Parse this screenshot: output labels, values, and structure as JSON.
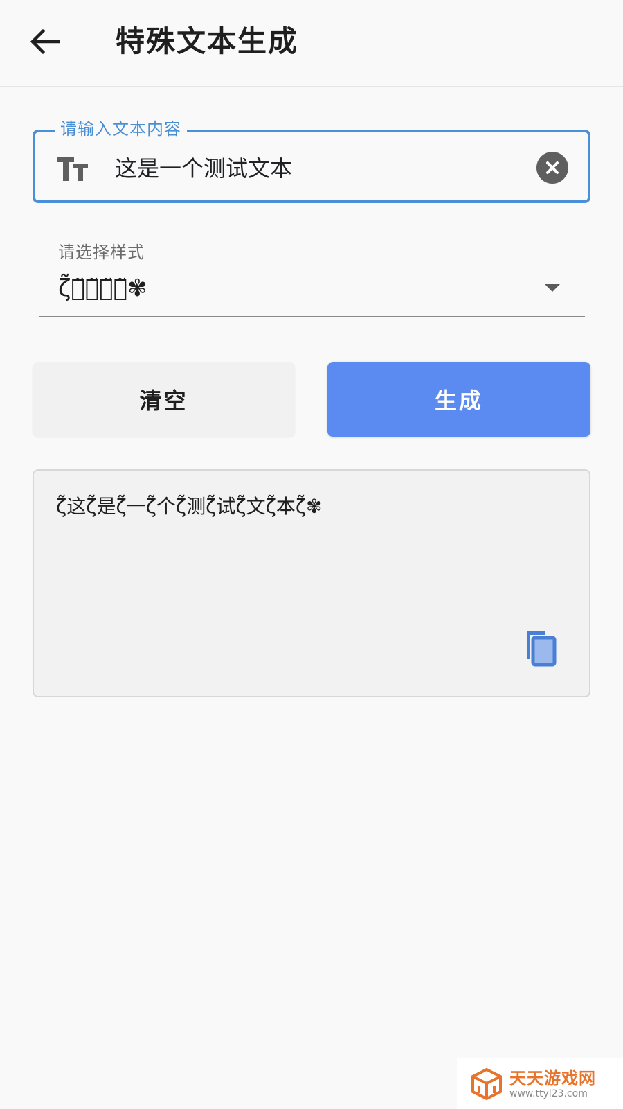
{
  "header": {
    "title": "特殊文本生成",
    "back_icon": "arrow-left-icon"
  },
  "input": {
    "label": "请输入文本内容",
    "value": "这是一个测试文本",
    "leading_icon": "text-format-icon",
    "clear_icon": "cancel-circle-icon",
    "focus_color": "#4a90d9"
  },
  "style_select": {
    "label": "请选择样式",
    "selected": "ζ̃测̃试̃测̃试̃✾"
  },
  "buttons": {
    "clear_label": "清空",
    "generate_label": "生成",
    "generate_color": "#5b8af0"
  },
  "output": {
    "text": "ζ̃这ζ̃是ζ̃一ζ̃个ζ̃测ζ̃试ζ̃文ζ̃本ζ̃✾",
    "copy_icon": "copy-icon"
  },
  "watermark": {
    "name": "天天游戏网",
    "url": "www.ttyl23.com",
    "color": "#e8732a"
  }
}
